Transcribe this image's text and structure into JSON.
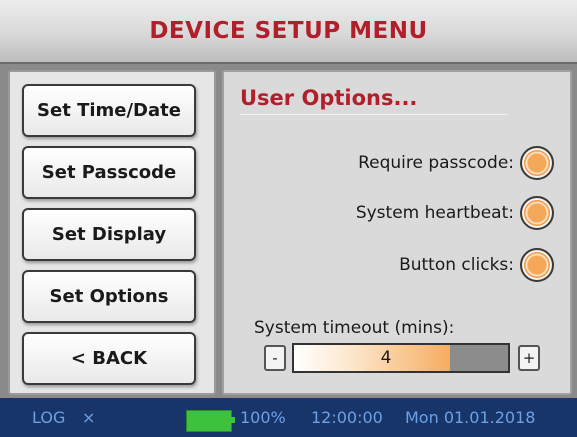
{
  "header": {
    "title": "DEVICE SETUP MENU"
  },
  "menu": {
    "items": [
      {
        "label": "Set Time/Date"
      },
      {
        "label": "Set Passcode"
      },
      {
        "label": "Set Display"
      },
      {
        "label": "Set Options"
      },
      {
        "label": "< BACK"
      }
    ]
  },
  "options": {
    "title": "User Options...",
    "rows": [
      {
        "label": "Require passcode:",
        "icon": "radio-button"
      },
      {
        "label": "System heartbeat:",
        "icon": "radio-button"
      },
      {
        "label": "Button clicks:",
        "icon": "radio-button"
      }
    ],
    "timeout": {
      "label": "System timeout (mins):",
      "value": "4",
      "minus": "-",
      "plus": "+",
      "fill_fraction": 0.73
    }
  },
  "status": {
    "log": "LOG",
    "log_close": "×",
    "battery": "100%",
    "time": "12:00:00",
    "date": "Mon 01.01.2018"
  },
  "colors": {
    "accent_title": "#b11f2b",
    "radio_orange": "#f29a49",
    "status_bg": "#18356a",
    "status_text": "#6da0e4",
    "battery": "#3ec23e"
  }
}
